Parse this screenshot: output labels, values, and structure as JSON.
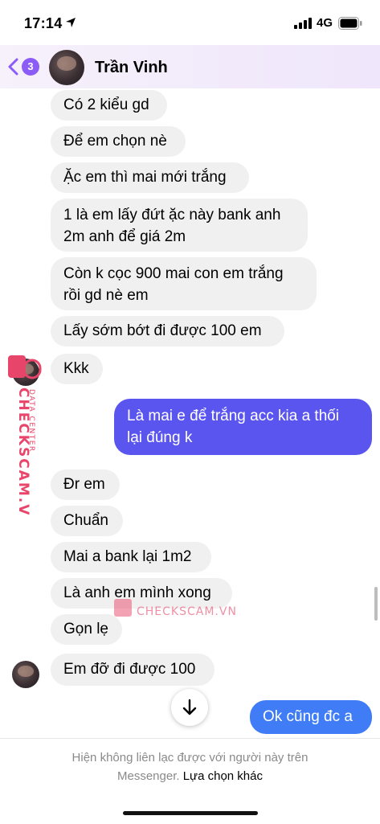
{
  "status": {
    "time": "17:14",
    "network": "4G"
  },
  "header": {
    "back_count": "3",
    "name": "Trần Vinh"
  },
  "messages": [
    {
      "text": "Có 2 kiểu gd"
    },
    {
      "text": "Để em chọn nè"
    },
    {
      "text": "Ặc em thì mai mới trắng"
    },
    {
      "line1": "1 là em lấy đứt ặc này bank anh",
      "line2": "2m anh để giá 2m"
    },
    {
      "line1": "Còn k cọc 900 mai con em trắng",
      "line2": "rồi gd nè em"
    },
    {
      "text": "Lấy sớm bớt đi được 100 em"
    },
    {
      "text": "Kkk"
    },
    {
      "line1": "Là mai e để trắng acc kia a thối",
      "line2": "lại đúng k"
    },
    {
      "text": "Đr em"
    },
    {
      "text": "Chuẩn"
    },
    {
      "text": "Mai a bank lại 1m2"
    },
    {
      "text": "Là anh em mình xong"
    },
    {
      "text": "Gọn lẹ"
    },
    {
      "text": "Em đỡ đi được 100"
    },
    {
      "text": "Ok cũng đc a"
    }
  ],
  "footer": {
    "notice_line1": "Hiện không liên lạc được với người này trên",
    "notice_prefix": "Messenger.",
    "notice_link": "Lựa chọn khác"
  },
  "watermark": {
    "vertical_big": "CHECKSCAM.VN",
    "vertical_small": "DATA CENTER",
    "center": "CHECKSCAM.VN"
  },
  "colors": {
    "outgoing": "#5b55f0",
    "outgoing_last": "#3f7cf5",
    "incoming": "#f0f0f0",
    "accent": "#8b5cf6",
    "watermark": "#e8456a"
  },
  "icons": [
    "location-arrow-icon",
    "signal-icon",
    "battery-icon",
    "back-chevron-icon",
    "arrow-down-icon"
  ]
}
